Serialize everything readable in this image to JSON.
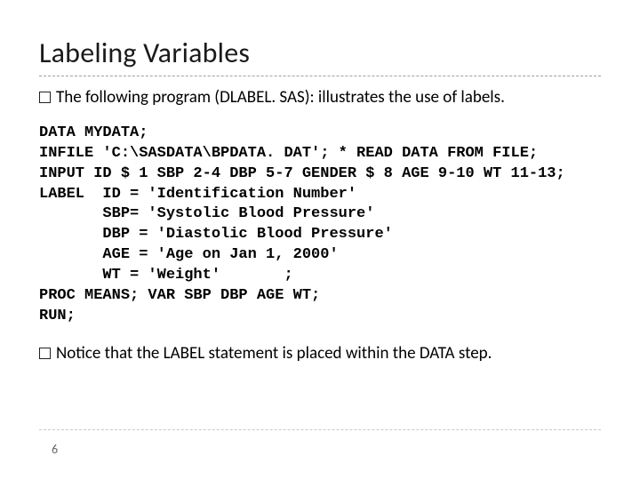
{
  "slide": {
    "title": "Labeling Variables",
    "bullet1": "The following program (DLABEL. SAS): illustrates the use of labels.",
    "bullet2": "Notice that the LABEL statement is placed within the DATA step.",
    "page_number": "6",
    "code_lines": [
      "DATA MYDATA;",
      "INFILE 'C:\\SASDATA\\BPDATA. DAT'; * READ DATA FROM FILE;",
      "INPUT ID $ 1 SBP 2-4 DBP 5-7 GENDER $ 8 AGE 9-10 WT 11-13;",
      "LABEL  ID = 'Identification Number'",
      "       SBP= 'Systolic Blood Pressure'",
      "       DBP = 'Diastolic Blood Pressure'",
      "       AGE = 'Age on Jan 1, 2000'",
      "       WT = 'Weight'       ;",
      "PROC MEANS; VAR SBP DBP AGE WT;",
      "RUN;"
    ]
  }
}
